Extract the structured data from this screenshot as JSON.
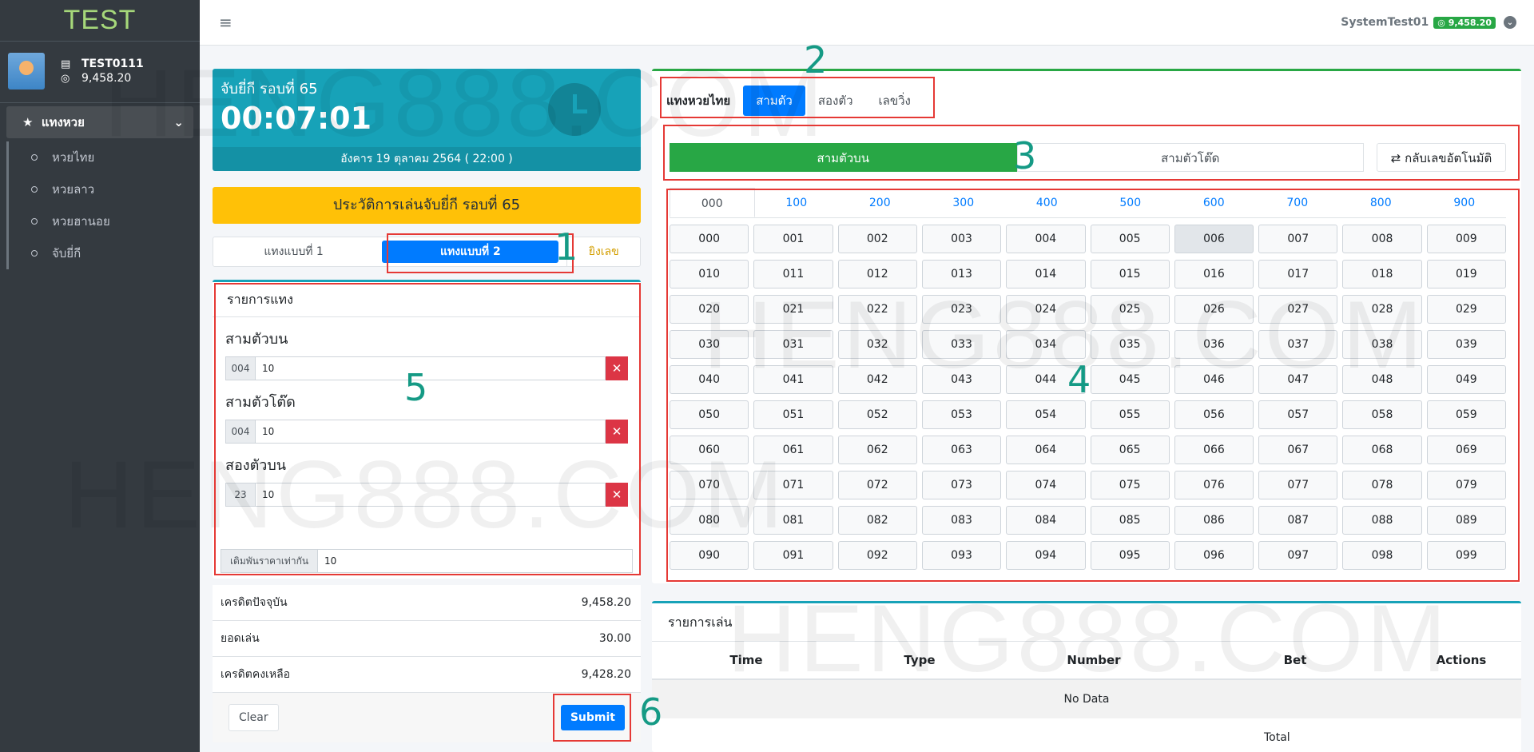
{
  "brand": "TEST",
  "user": {
    "name": "TEST0111",
    "balance": "9,458.20"
  },
  "nav": {
    "main": "แทงหวย",
    "items": [
      "หวยไทย",
      "หวยลาว",
      "หวยฮานอย",
      "จับยี่กี"
    ]
  },
  "topbar": {
    "username": "SystemTest01",
    "balance": "9,458.20"
  },
  "timer": {
    "title": "จับยี่กี รอบที่ 65",
    "time": "00:07:01",
    "date": "อังคาร 19 ตุลาคม 2564 ( 22:00 )"
  },
  "history_button": "ประวัติการเล่นจับยี่กี รอบที่ 65",
  "modes": [
    "แทงแบบที่ 1",
    "แทงแบบที่ 2",
    "ยิงเลข"
  ],
  "bet_list": {
    "title": "รายการแทง",
    "groups": [
      {
        "label": "สามตัวบน",
        "number": "004",
        "value": "10"
      },
      {
        "label": "สามตัวโต๊ด",
        "number": "004",
        "value": "10"
      },
      {
        "label": "สองตัวบน",
        "number": "23",
        "value": "10"
      }
    ],
    "extra_label": "เดิมพันราคาเท่ากัน",
    "extra_value": "10"
  },
  "summary": {
    "rows": [
      {
        "label": "เครดิตปัจจุบัน",
        "value": "9,458.20"
      },
      {
        "label": "ยอดเล่น",
        "value": "30.00"
      },
      {
        "label": "เครดิตคงเหลือ",
        "value": "9,428.20"
      }
    ],
    "clear": "Clear",
    "submit": "Submit"
  },
  "lottery": {
    "title": "แทงหวยไทย",
    "tabs": [
      "สามตัว",
      "สองตัว",
      "เลขวิ่ง"
    ],
    "types": [
      "สามตัวบน",
      "สามตัวโต๊ด"
    ],
    "auto_reverse": "กลับเลขอัตโนมัติ",
    "hundreds": [
      "000",
      "100",
      "200",
      "300",
      "400",
      "500",
      "600",
      "700",
      "800",
      "900"
    ]
  },
  "play_list": {
    "title": "รายการเล่น",
    "columns": [
      "Time",
      "Type",
      "Number",
      "Bet",
      "Actions"
    ],
    "empty": "No Data",
    "total": "Total"
  },
  "markers": [
    "1",
    "2",
    "3",
    "4",
    "5",
    "6"
  ],
  "watermark": "HENG888.COM"
}
